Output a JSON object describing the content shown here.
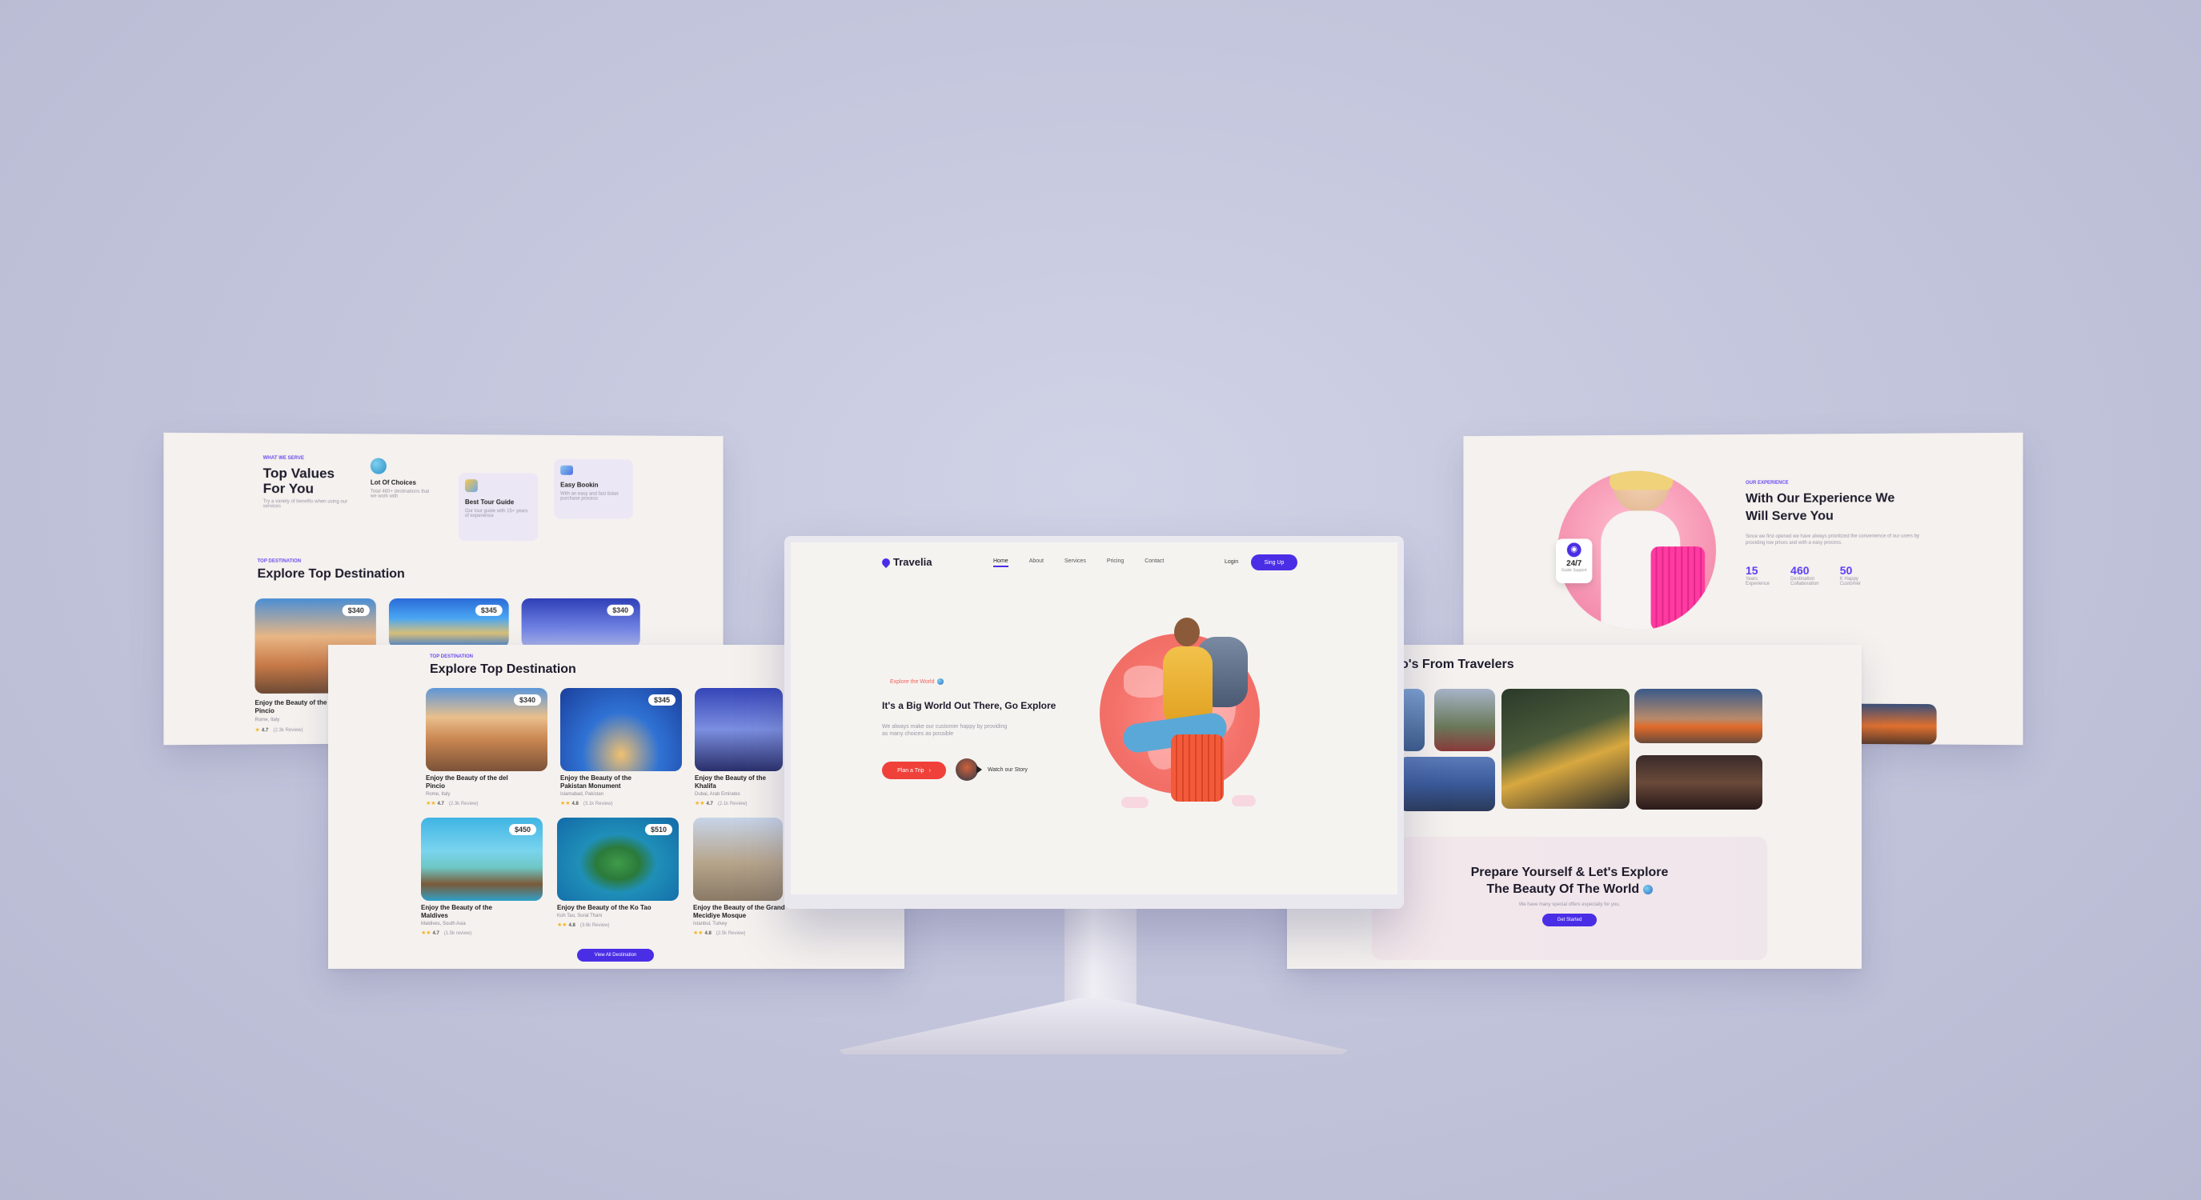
{
  "colors": {
    "accent": "#4a2ee6",
    "coral": "#f0625a",
    "cream": "#f4f1ee"
  },
  "left_back": {
    "eyebrow": "WHAT WE SERVE",
    "title_line1": "Top Values",
    "title_line2": "For You",
    "desc": "Try a variety of benefits when using our services",
    "features": [
      {
        "icon": "globe-icon",
        "title": "Lot Of Choices",
        "desc": "Total 460+ destinations that we work with"
      },
      {
        "icon": "guide-icon",
        "title": "Best Tour Guide",
        "desc": "Our tour guide with 15+ years of experience"
      },
      {
        "icon": "booking-icon",
        "title": "Easy Bookin",
        "desc": "With an easy and fast ticket purchase process"
      }
    ],
    "dest_eyebrow": "TOP DESTINATION",
    "dest_title": "Explore Top Destination",
    "cards": [
      {
        "price": "$340",
        "title_line1": "Enjoy the Beauty of the",
        "title_line2": "Pincio",
        "sub": "Rome, Italy",
        "rating": "4.7",
        "reviews": "(2.3k Review)"
      },
      {
        "price": "$345"
      },
      {
        "price": "$340"
      }
    ]
  },
  "left_front": {
    "eyebrow": "TOP DESTINATION",
    "title": "Explore Top Destination",
    "cards": [
      {
        "price": "$340",
        "title_line1": "Enjoy the Beauty of the del",
        "title_line2": "Pincio",
        "sub": "Rome, Italy",
        "rating": "4.7",
        "reviews": "(2.3k Review)"
      },
      {
        "price": "$345",
        "title_line1": "Enjoy the Beauty of the",
        "title_line2": "Pakistan Monument",
        "sub": "Islamabad, Pakistan",
        "rating": "4.8",
        "reviews": "(3.1k Review)"
      },
      {
        "price": "",
        "title_line1": "Enjoy the Beauty of the",
        "title_line2": "Khalifa",
        "sub": "Dubai, Arab Emirates",
        "rating": "4.7",
        "reviews": "(2.1k Review)"
      },
      {
        "price": "$450",
        "title_line1": "Enjoy the Beauty of the",
        "title_line2": "Maldives",
        "sub": "Maldives, South Asia",
        "rating": "4.7",
        "reviews": "(1.5k review)"
      },
      {
        "price": "$510",
        "title_line1": "Enjoy the Beauty of the Ko Tao",
        "title_line2": "",
        "sub": "Koh Tao, Surat Thani",
        "rating": "4.8",
        "reviews": "(3.6k Review)"
      },
      {
        "price": "",
        "title_line1": "Enjoy the Beauty of the Grand",
        "title_line2": "Mecidiye Mosque",
        "sub": "Istanbul, Turkey",
        "rating": "4.8",
        "reviews": "(2.5k Review)"
      }
    ],
    "button": "View All Destination"
  },
  "monitor": {
    "logo": "Travelia",
    "nav": [
      "Home",
      "About",
      "Services",
      "Pricing",
      "Contact"
    ],
    "login": "Login",
    "signup": "Sing Up",
    "pill": "Explore the World",
    "headline": "It's a Big World Out There, Go Explore",
    "desc_line1": "We always make our customer happy by providing",
    "desc_line2": "as many choices as possible",
    "cta": "Plan a Trip",
    "story": "Watch our Story"
  },
  "right_back": {
    "eyebrow": "OUR EXPERIENCE",
    "title_line1": "With Our Experience We",
    "title_line2": "Will Serve You",
    "desc": "Since we first opened we have always prioritized the convenience of our users by providing low prices and with a easy process.",
    "badge_value": "24/7",
    "badge_label": "Guide Support",
    "stats": [
      {
        "value": "15",
        "label_line1": "Years",
        "label_line2": "Experience"
      },
      {
        "value": "460",
        "label_line1": "Destination",
        "label_line2": "Collaboration"
      },
      {
        "value": "50",
        "label_line1": "K Happy",
        "label_line2": "Customer"
      }
    ]
  },
  "right_front": {
    "title": "o's From Travelers",
    "cta_title_line1": "Prepare Yourself & Let's Explore",
    "cta_title_line2": "The Beauty Of The World",
    "cta_desc": "We have many special offers especially for you.",
    "cta_button": "Get Started"
  }
}
